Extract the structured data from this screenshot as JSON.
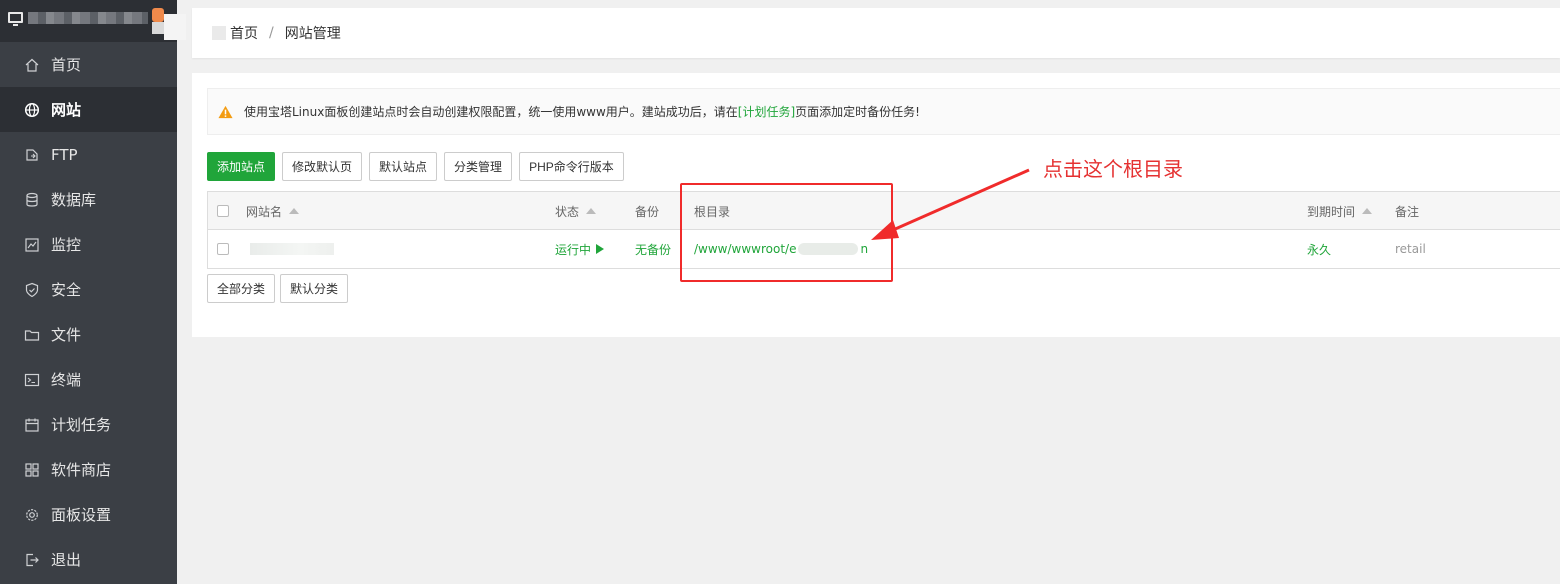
{
  "sidebar": {
    "items": [
      {
        "label": "首页",
        "icon": "home-icon"
      },
      {
        "label": "网站",
        "icon": "globe-icon",
        "active": true
      },
      {
        "label": "FTP",
        "icon": "ftp-icon"
      },
      {
        "label": "数据库",
        "icon": "database-icon"
      },
      {
        "label": "监控",
        "icon": "monitor-chart-icon"
      },
      {
        "label": "安全",
        "icon": "shield-icon"
      },
      {
        "label": "文件",
        "icon": "folder-icon"
      },
      {
        "label": "终端",
        "icon": "terminal-icon"
      },
      {
        "label": "计划任务",
        "icon": "calendar-icon"
      },
      {
        "label": "软件商店",
        "icon": "grid-icon"
      },
      {
        "label": "面板设置",
        "icon": "gear-icon"
      },
      {
        "label": "退出",
        "icon": "logout-icon"
      }
    ]
  },
  "breadcrumb": {
    "home": "首页",
    "separator": "/",
    "current": "网站管理"
  },
  "alert": {
    "text_before": "使用宝塔Linux面板创建站点时会自动创建权限配置，统一使用www用户。建站成功后，请在",
    "link": "[计划任务]",
    "text_after": "页面添加定时备份任务!"
  },
  "toolbar": {
    "add_site": "添加站点",
    "edit_default_page": "修改默认页",
    "default_site": "默认站点",
    "category_manage": "分类管理",
    "php_cli_version": "PHP命令行版本"
  },
  "table": {
    "headers": {
      "site_name": "网站名",
      "status": "状态",
      "backup": "备份",
      "root_dir": "根目录",
      "expire": "到期时间",
      "note": "备注"
    },
    "rows": [
      {
        "status": "运行中",
        "backup": "无备份",
        "root_prefix": "/www/wwwroot/e",
        "root_suffix": "n",
        "expire": "永久",
        "note": "retail"
      }
    ]
  },
  "categories": {
    "all": "全部分类",
    "default": "默认分类"
  },
  "annotation": {
    "text": "点击这个根目录"
  },
  "colors": {
    "accent_green": "#20a53a",
    "annotation_red": "#e53131",
    "sidebar_bg": "#3b3f45"
  }
}
